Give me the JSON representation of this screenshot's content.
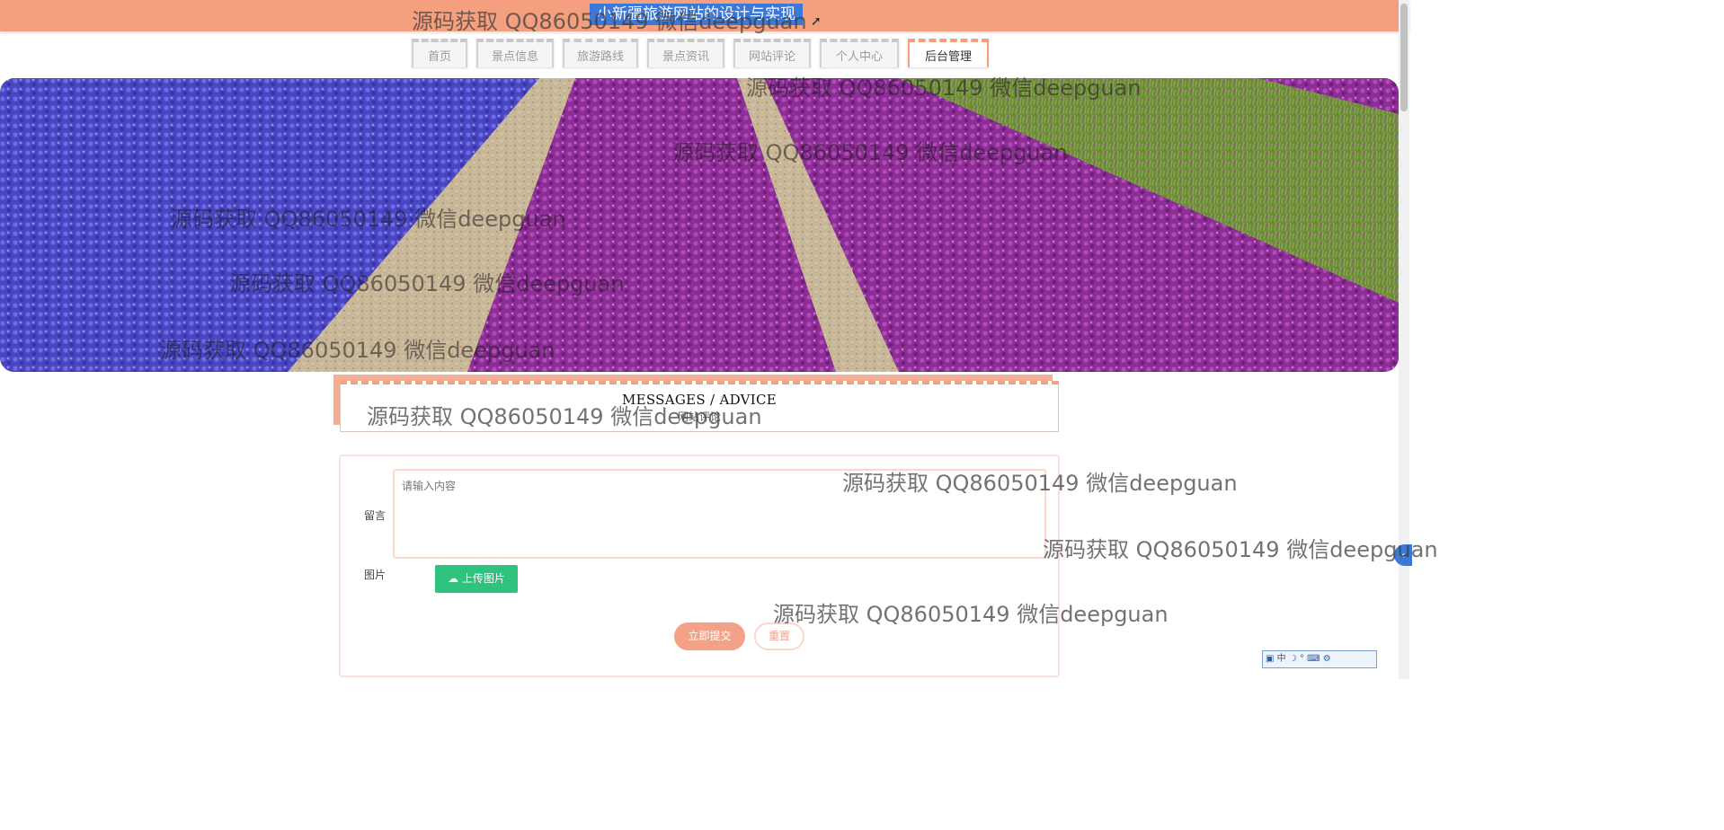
{
  "header": {
    "site_title": "小新疆旅游网站的设计与实现"
  },
  "nav": {
    "items": [
      {
        "label": "首页",
        "active": false
      },
      {
        "label": "景点信息",
        "active": false
      },
      {
        "label": "旅游路线",
        "active": false
      },
      {
        "label": "景点资讯",
        "active": false
      },
      {
        "label": "网站评论",
        "active": false
      },
      {
        "label": "个人中心",
        "active": false
      },
      {
        "label": "后台管理",
        "active": true
      }
    ]
  },
  "section": {
    "title_en": "MESSAGES / ADVICE",
    "title_cn": "网站评论"
  },
  "form": {
    "message_label": "留言",
    "message_placeholder": "请输入内容",
    "image_label": "图片",
    "upload_label": "上传图片",
    "submit_label": "立即提交",
    "reset_label": "重置"
  },
  "ime": {
    "text": "中 ☽ ° ⌨ ⚙"
  },
  "watermark_text": "源码获取 QQ86050149 微信deepguan",
  "colors": {
    "accent": "#f4a07f",
    "upload": "#2ec27e",
    "title_highlight": "#3c78d8"
  }
}
